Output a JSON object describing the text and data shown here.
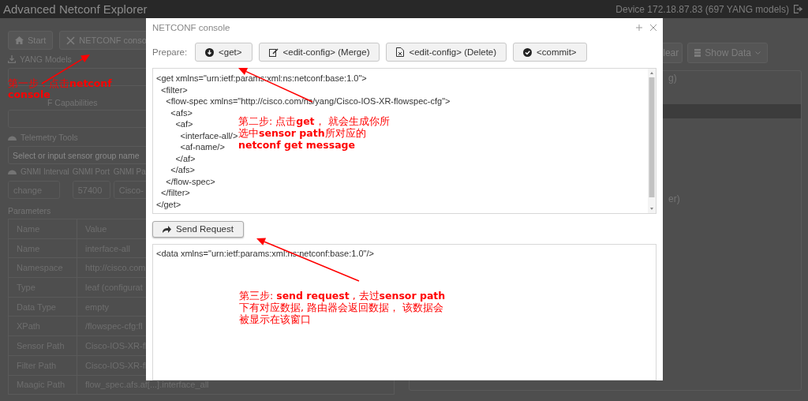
{
  "app": {
    "title": "Advanced Netconf Explorer",
    "device": "Device 172.18.87.83 (697 YANG models)"
  },
  "left_panel": {
    "toolbar": [
      "Start",
      "NETCONF conso"
    ],
    "yang_models_label": "YANG Models",
    "capabilities_label": "F Capabilities",
    "telemetry_label": "Telemetry Tools",
    "sensor_group_placeholder": "Select or input sensor group name",
    "gnmi_fields": [
      {
        "label": "GNMI Interval",
        "value": "change"
      },
      {
        "label": "GNMI Port",
        "value": "57400"
      },
      {
        "label": "GNMI Pa",
        "value": "Cisco-"
      }
    ],
    "parameters": {
      "title": "Parameters",
      "columns": [
        "Name",
        "Value"
      ],
      "rows": [
        [
          "Name",
          "interface-all"
        ],
        [
          "Namespace",
          "http://cisco.com"
        ],
        [
          "Type",
          "leaf (configurat"
        ],
        [
          "Data Type",
          "empty"
        ],
        [
          "XPath",
          "/flowspec-cfg:fl"
        ],
        [
          "Sensor Path",
          "Cisco-IOS-XR-fl"
        ],
        [
          "Filter Path",
          "Cisco-IOS-XR-fl"
        ],
        [
          "Maagic Path",
          "flow_spec.afs.af[...].interface_all"
        ]
      ]
    }
  },
  "right_panel": {
    "toolbar": [
      "lear",
      "Show Data"
    ],
    "fragments": [
      "g)",
      "er)"
    ]
  },
  "console": {
    "title": "NETCONF console",
    "prepare_label": "Prepare:",
    "actions": [
      "<get>",
      "<edit-config> (Merge)",
      "<edit-config> (Delete)",
      "<commit>"
    ],
    "request": [
      "<get xmlns=\"urn:ietf:params:xml:ns:netconf:base:1.0\">",
      "  <filter>",
      "    <flow-spec xmlns=\"http://cisco.com/ns/yang/Cisco-IOS-XR-flowspec-cfg\">",
      "      <afs>",
      "        <af>",
      "          <interface-all/>",
      "          <af-name/>",
      "        </af>",
      "      </afs>",
      "    </flow-spec>",
      "  </filter>",
      "</get>"
    ],
    "send_button": "Send Request",
    "response": "<data xmlns=\"urn:ietf:params:xml:ns:netconf:base:1.0\"/>"
  },
  "annotations": [
    {
      "text": "第一步：点击**netconf console**"
    },
    {
      "text": "第二步: 点击**get**， 就会生成你所选中**sensor path**所对应的**netconf get message**"
    },
    {
      "text": "第三步: **send request** , 去过**sensor path**下有对应数据, 路由器会返回数据， 该数据会被显示在该窗口"
    }
  ]
}
